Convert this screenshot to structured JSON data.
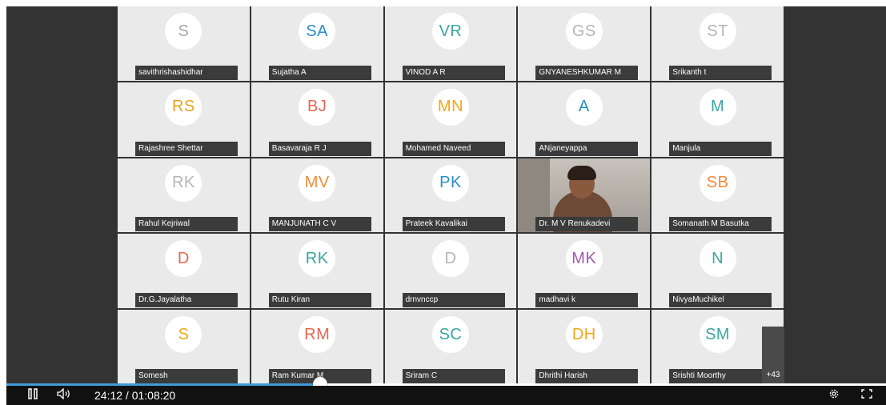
{
  "meeting": {
    "more_count": "+43",
    "participants": [
      {
        "initials": "S",
        "name": "savithrishashidhar",
        "color": "#a8a8a8"
      },
      {
        "initials": "SA",
        "name": "Sujatha A",
        "color": "#2a8fc4"
      },
      {
        "initials": "VR",
        "name": "VINOD A R",
        "color": "#3aa6a0"
      },
      {
        "initials": "GS",
        "name": "GNYANESHKUMAR M",
        "color": "#b5b5b5"
      },
      {
        "initials": "ST",
        "name": "Srikanth t",
        "color": "#b5b5b5"
      },
      {
        "initials": "RS",
        "name": "Rajashree Shettar",
        "color": "#e8a21a"
      },
      {
        "initials": "BJ",
        "name": "Basavaraja R J",
        "color": "#e8664f"
      },
      {
        "initials": "MN",
        "name": "Mohamed Naveed",
        "color": "#f0a818"
      },
      {
        "initials": "A",
        "name": "ANjaneyappa",
        "color": "#2a8fc4"
      },
      {
        "initials": "M",
        "name": "Manjula",
        "color": "#3aa6a0"
      },
      {
        "initials": "RK",
        "name": "Rahul Kejriwal",
        "color": "#b5b5b5"
      },
      {
        "initials": "MV",
        "name": "MANJUNATH C V",
        "color": "#f08a3a"
      },
      {
        "initials": "PK",
        "name": "Prateek Kavalikai",
        "color": "#2a8fc4"
      },
      {
        "initials": "",
        "name": "Dr. M V Renukadevi",
        "color": "",
        "video": true
      },
      {
        "initials": "SB",
        "name": "Somanath M Basutka",
        "color": "#f08a3a"
      },
      {
        "initials": "D",
        "name": "Dr.G.Jayalatha",
        "color": "#e8664f"
      },
      {
        "initials": "RK",
        "name": "Rutu Kiran",
        "color": "#3aa6a0"
      },
      {
        "initials": "D",
        "name": "drnvnccp",
        "color": "#b5b5b5"
      },
      {
        "initials": "MK",
        "name": "madhavi k",
        "color": "#a05aa8"
      },
      {
        "initials": "N",
        "name": "NivyaMuchikel",
        "color": "#3aa6a0"
      },
      {
        "initials": "S",
        "name": "Somesh",
        "color": "#f0a818"
      },
      {
        "initials": "RM",
        "name": "Ram Kumar M",
        "color": "#e8664f"
      },
      {
        "initials": "SC",
        "name": "Sriram C",
        "color": "#3aa6a0"
      },
      {
        "initials": "DH",
        "name": "Dhrithi Harish",
        "color": "#f0a818"
      },
      {
        "initials": "SM",
        "name": "Srishti Moorthy",
        "color": "#3aa6a0"
      }
    ]
  },
  "player": {
    "time_display": "24:12 / 01:08:20",
    "current_time": "24:12",
    "duration": "01:08:20",
    "progress_fraction": 0.357,
    "accent_color": "#3d9bd9",
    "icons": {
      "play_pause": "pause-icon",
      "volume": "volume-icon",
      "settings": "gear-icon",
      "fullscreen": "fullscreen-icon"
    }
  }
}
